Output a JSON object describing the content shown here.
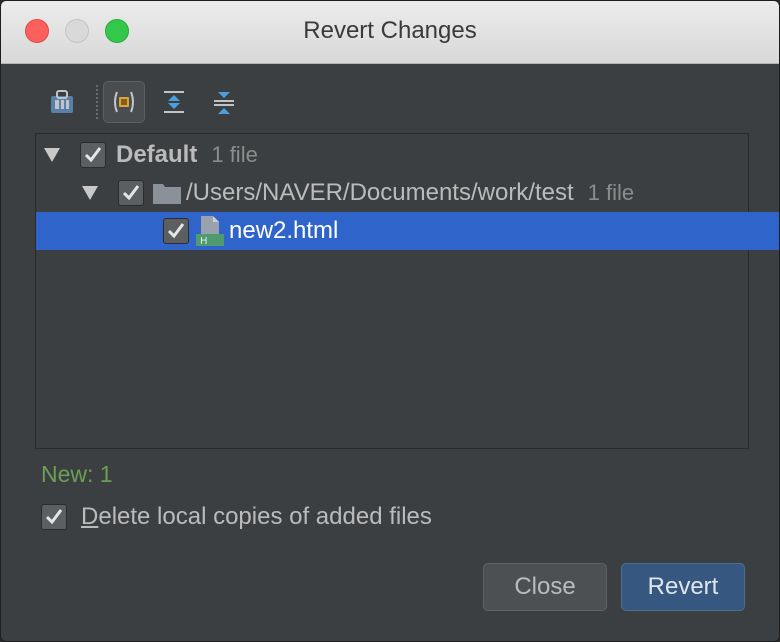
{
  "window": {
    "title": "Revert Changes"
  },
  "toolbar": {
    "icons": [
      "group-by-directory-icon",
      "show-directories-icon",
      "expand-all-icon",
      "collapse-all-icon"
    ]
  },
  "tree": {
    "changelist": {
      "name": "Default",
      "count": "1 file",
      "checked": true,
      "expanded": true
    },
    "directory": {
      "path": "/Users/NAVER/Documents/work/test",
      "count": "1 file",
      "checked": true,
      "expanded": true
    },
    "file": {
      "name": "new2.html",
      "checked": true,
      "selected": true,
      "icon": "html-file-icon"
    }
  },
  "summary": {
    "text": "New: 1"
  },
  "options": {
    "delete_local": {
      "mnemonic": "D",
      "rest": "elete local copies of added files",
      "checked": true
    }
  },
  "buttons": {
    "close": "Close",
    "revert": "Revert"
  },
  "colors": {
    "background": "#3c3f41",
    "selection": "#2f65ca",
    "summary_green": "#6a9f55",
    "default_button": "#365880"
  }
}
